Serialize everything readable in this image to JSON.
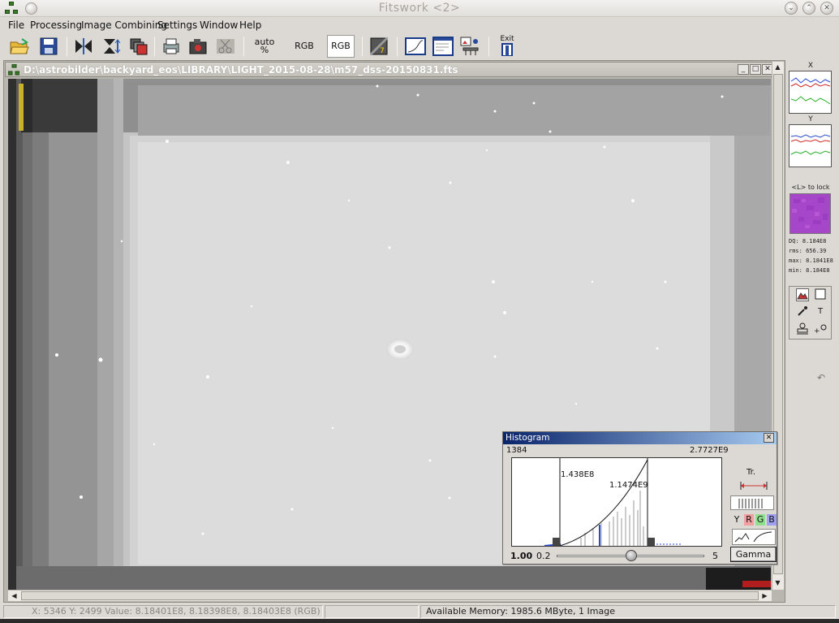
{
  "app": {
    "title": "Fitswork <2>"
  },
  "menu": [
    "File",
    "Processing",
    "Image Combining",
    "Settings",
    "Window",
    "Help"
  ],
  "toolbar": {
    "auto_label": "auto",
    "auto_pct": "%",
    "rgb_label_1": "RGB",
    "rgb_label_2": "RGB",
    "exit_label": "Exit"
  },
  "document": {
    "path": "D:\\astrobilder\\backyard_eos\\LIBRARY\\LIGHT_2015-08-28\\m57_dss-20150831.fts"
  },
  "right_panel": {
    "x_label": "X",
    "y_label": "Y",
    "lock_hint": "<L> to lock",
    "stats": [
      "DQ: 8.184E8",
      "rms: 656.39",
      "max: 8.1841E8",
      "min: 8.184E8"
    ]
  },
  "histogram": {
    "title": "Histogram",
    "min": "1384",
    "max": "2.7727E9",
    "left_marker": "1.438E8",
    "right_marker": "1.1474E9",
    "gamma_value": "1.00",
    "slider_min": "0.2",
    "slider_max": "5",
    "slider_level": 0.5,
    "tr_label": "Tr.",
    "channels": [
      "Y",
      "R",
      "G",
      "B"
    ],
    "gamma_button": "Gamma"
  },
  "status": {
    "coords": "X: 5346  Y: 2499  Value: 8.18401E8, 8.18398E8, 8.18403E8 (RGB)",
    "memory": "Available Memory: 1985.6 MByte, 1 Image"
  },
  "colors": {
    "title_gradient_start": "#0a246a",
    "title_gradient_end": "#a6caf0",
    "channel_r": "#f0a0a0",
    "channel_g": "#90e090",
    "channel_b": "#a0a0f0"
  }
}
